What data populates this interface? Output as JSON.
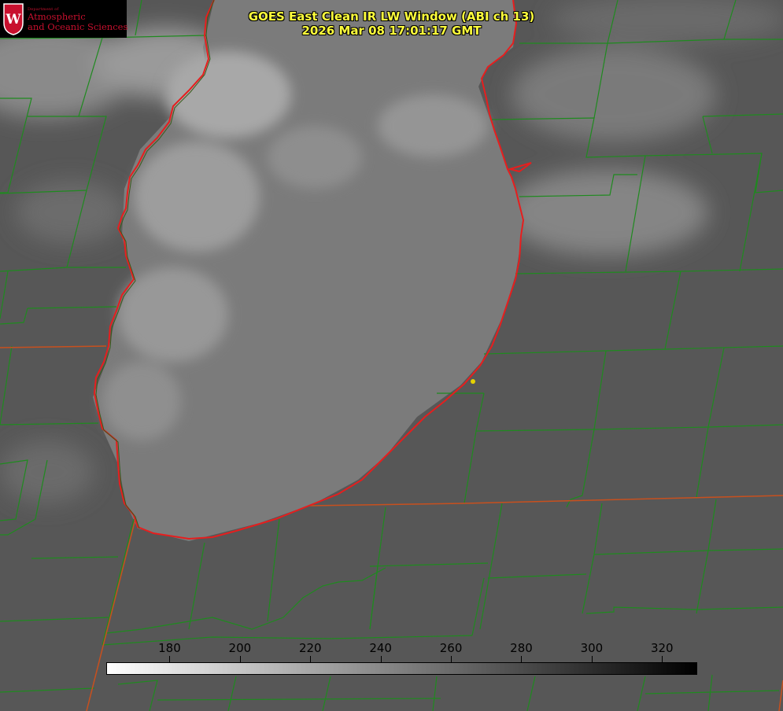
{
  "logo": {
    "dept_small": "Department of",
    "line1": "Atmospheric",
    "line2": "and Oceanic Sciences",
    "seal_letter": "W",
    "accent_color": "#c8102e"
  },
  "title": {
    "line1": "GOES East Clean IR LW Window (ABI ch 13)",
    "line2": "2026 Mar 08 17:01:17 GMT",
    "color": "#ffff3c"
  },
  "colorbar": {
    "ticks": [
      "180",
      "200",
      "220",
      "240",
      "260",
      "280",
      "300",
      "320"
    ],
    "tick_values": [
      180,
      200,
      220,
      240,
      260,
      280,
      300,
      320
    ],
    "range": [
      162,
      330
    ],
    "colormap": "white-to-black grayscale"
  },
  "map": {
    "lake_outline_color": "#e61e1e",
    "county_border_color": "#1f8a1f",
    "state_border_color": "#c8501e",
    "marker_color": "#e6d200"
  }
}
